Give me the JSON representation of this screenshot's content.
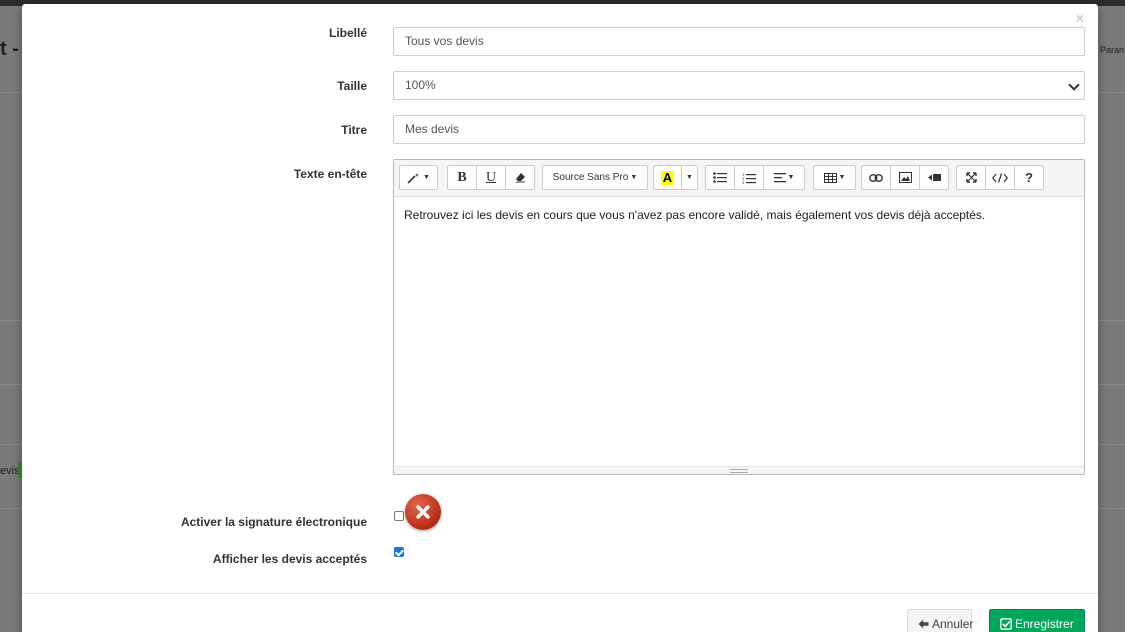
{
  "background": {
    "left_fragment": "t -",
    "devis_fragment": "evis",
    "right_fragment": "Paran"
  },
  "modal": {
    "close_symbol": "×",
    "libelle": {
      "label": "Libellé",
      "value": "Tous vos devis"
    },
    "taille": {
      "label": "Taille",
      "value": "100%"
    },
    "titre": {
      "label": "Titre",
      "value": "Mes devis"
    },
    "texte_entete": {
      "label": "Texte en-tête",
      "toolbar": {
        "font_name": "Source Sans Pro",
        "highlight_letter": "A",
        "help": "?"
      },
      "content": "Retrouvez ici les devis en cours que vous n'avez pas encore validé, mais également vos devis déjà acceptés."
    },
    "signature": {
      "label": "Activer la signature électronique",
      "checked": false
    },
    "afficher": {
      "label": "Afficher les devis acceptés",
      "checked": true
    },
    "buttons": {
      "cancel": "Annuler",
      "save": "Enregistrer"
    }
  },
  "colors": {
    "save_green": "#00a65a",
    "error_red": "#c0391b",
    "checkbox_blue": "#1a73e8"
  }
}
